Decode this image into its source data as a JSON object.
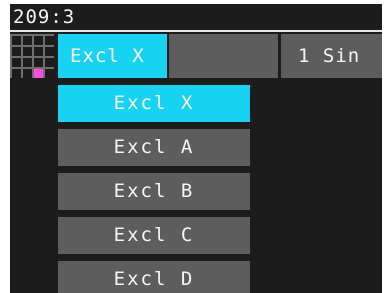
{
  "status": {
    "position": "209:3"
  },
  "header": {
    "active_label": "Excl X",
    "blank_label": "",
    "right_label": "1 Sin"
  },
  "menu": {
    "items": [
      {
        "label": "Excl X",
        "selected": true
      },
      {
        "label": "Excl A",
        "selected": false
      },
      {
        "label": "Excl B",
        "selected": false
      },
      {
        "label": "Excl C",
        "selected": false
      },
      {
        "label": "Excl D",
        "selected": false
      }
    ]
  },
  "colors": {
    "background": "#1c1c1c",
    "accent": "#18d2f2",
    "button": "#5d5d5d",
    "text": "#f5f5f5",
    "grid_marker": "#ff4fe0"
  },
  "icons": {
    "pattern_grid": "grid-icon"
  }
}
